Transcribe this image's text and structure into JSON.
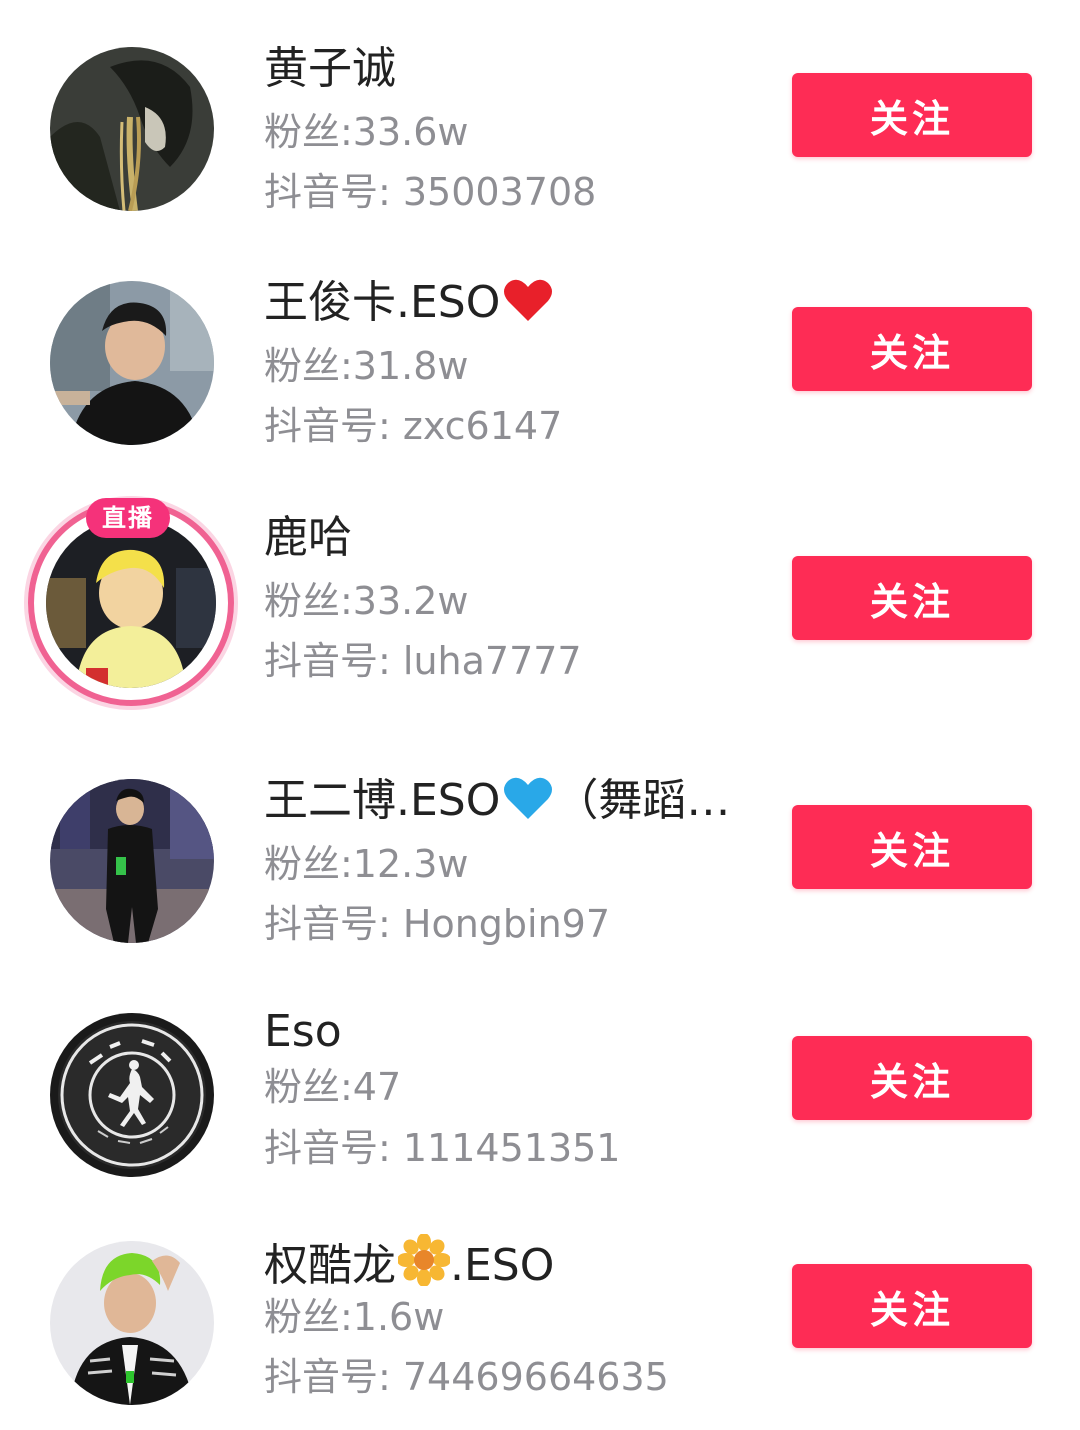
{
  "users": [
    {
      "name": "黄子诚",
      "emoji": "",
      "fans": "粉丝:33.6w",
      "douyin_id": "抖音号: 35003708",
      "follow_label": "关注"
    },
    {
      "name": "王俊卡.ESO",
      "emoji": "red-heart",
      "fans": "粉丝:31.8w",
      "douyin_id": "抖音号: zxc6147",
      "follow_label": "关注"
    },
    {
      "name": "鹿哈",
      "emoji": "",
      "live_badge": "直播",
      "fans": "粉丝:33.2w",
      "douyin_id": "抖音号: luha7777",
      "follow_label": "关注"
    },
    {
      "name": "王二博.ESO",
      "emoji": "blue-heart",
      "name_suffix": "（舞蹈…",
      "fans": "粉丝:12.3w",
      "douyin_id": "抖音号: Hongbin97",
      "follow_label": "关注"
    },
    {
      "name": "Eso",
      "emoji": "",
      "fans": "粉丝:47",
      "douyin_id": "抖音号: 111451351",
      "follow_label": "关注"
    },
    {
      "name": "权酷龙",
      "emoji": "sunflower",
      "name_suffix": ".ESO",
      "fans": "粉丝:1.6w",
      "douyin_id": "抖音号: 74469664635",
      "follow_label": "关注"
    }
  ],
  "colors": {
    "follow_button": "#fe2c55",
    "live_ring": "#f06292",
    "secondary_text": "#8e8e93",
    "primary_text": "#222222"
  }
}
